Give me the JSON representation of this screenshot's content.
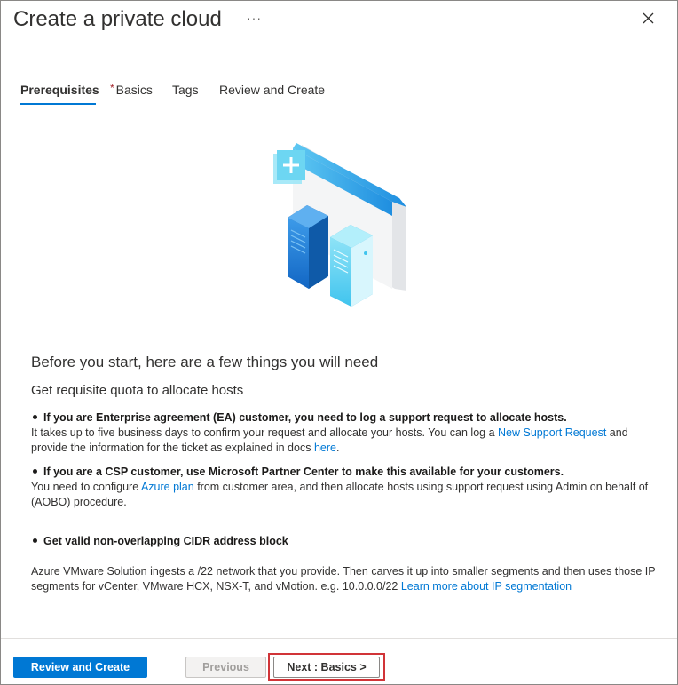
{
  "header": {
    "title": "Create a private cloud",
    "more": "···"
  },
  "tabs": [
    {
      "label": "Prerequisites",
      "active": true,
      "required": false
    },
    {
      "label": "Basics",
      "active": false,
      "required": true,
      "required_marker": "*"
    },
    {
      "label": "Tags",
      "active": false,
      "required": false
    },
    {
      "label": "Review and Create",
      "active": false,
      "required": false
    }
  ],
  "content": {
    "heading": "Before you start, here are a few things you will need",
    "subheading": "Get requisite quota to allocate hosts",
    "items": [
      {
        "bullet": "If you are Enterprise agreement (EA) customer, you need to log a support request to allocate hosts.",
        "text_before": "It takes up to five business days to confirm your request and allocate your hosts. You can log a ",
        "link1": "New Support Request",
        "text_middle": " and provide the information for the ticket as explained in docs ",
        "link2": "here",
        "text_after": "."
      },
      {
        "bullet": "If you are a CSP customer, use Microsoft Partner Center to make this available for your customers.",
        "text_before": "You need to configure ",
        "link1": "Azure plan",
        "text_after": " from customer area, and then allocate hosts using support request using Admin on behalf of (AOBO) procedure."
      },
      {
        "bullet": "Get valid non-overlapping CIDR address block"
      }
    ],
    "cidr_text": "Azure VMware Solution ingests a /22 network that you provide. Then carves it up into smaller segments and then uses those IP segments for vCenter, VMware HCX, NSX-T, and vMotion. e.g. 10.0.0.0/22 ",
    "cidr_link": "Learn more about IP segmentation"
  },
  "footer": {
    "review_create": "Review and Create",
    "previous": "Previous",
    "next": "Next : Basics >"
  },
  "colors": {
    "accent": "#0078d4",
    "highlight": "#d13438",
    "required": "#a4262c"
  }
}
